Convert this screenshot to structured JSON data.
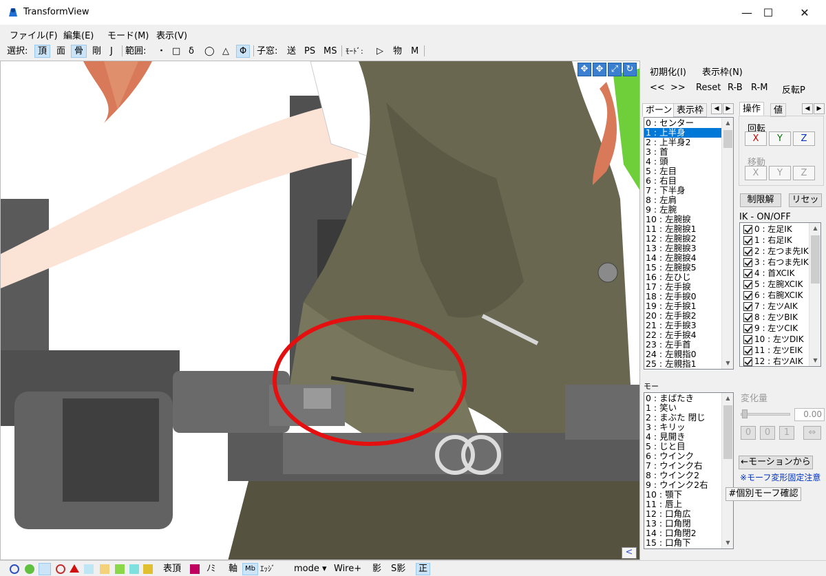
{
  "window": {
    "title": "TransformView",
    "minimize": "—",
    "maximize": "☐",
    "close": "✕"
  },
  "menu": [
    "ファイル(F)",
    "編集(E)",
    "モード(M)",
    "表示(V)"
  ],
  "toolbar": {
    "select_label": "選択:",
    "select": [
      "頂",
      "面",
      "骨",
      "剛",
      "J"
    ],
    "range_label": "範囲:",
    "range": [
      "・",
      "□",
      "δ",
      "◯",
      "△",
      "Φ"
    ],
    "child_label": "子窓:",
    "child": [
      "送",
      "PS",
      "MS"
    ],
    "mode_label": "ﾓｰﾄﾞ:",
    "mode": [
      "▷",
      "物",
      "M"
    ]
  },
  "panel": {
    "init": "初期化(I)",
    "display_frame": "表示枠(N)",
    "nav": [
      "<<",
      ">>",
      "Reset",
      "R-B",
      "R-M",
      "反転P"
    ],
    "left_tabs": [
      "ボーン",
      "表示枠"
    ],
    "right_tabs": [
      "操作",
      "値"
    ],
    "rotate_label": "回転",
    "move_label": "移動",
    "axes": [
      "X",
      "Y",
      "Z"
    ],
    "unlock": "制限解",
    "reset": "リセッ",
    "ik_label": "IK - ON/OFF",
    "morph_header": "モー",
    "change_label": "変化量",
    "change_value": "0.00",
    "morph_small": [
      "0",
      "0",
      "1",
      "⇔"
    ],
    "from_motion": "←モーションから",
    "note": "※モーフ変形固定注意",
    "check_morph": "#個別モーフ確認"
  },
  "bones": [
    "0 : センター",
    "1 : 上半身",
    "2 : 上半身2",
    "3 : 首",
    "4 : 頭",
    "5 : 左目",
    "6 : 右目",
    "7 : 下半身",
    "8 : 左肩",
    "9 : 左腕",
    "10 : 左腕捩",
    "11 : 左腕捩1",
    "12 : 左腕捩2",
    "13 : 左腕捩3",
    "14 : 左腕捩4",
    "15 : 左腕捩5",
    "16 : 左ひじ",
    "17 : 左手捩",
    "18 : 左手捩0",
    "19 : 左手捩1",
    "20 : 左手捩2",
    "21 : 左手捩3",
    "22 : 左手捩4",
    "23 : 左手首",
    "24 : 左親指0",
    "25 : 左親指1"
  ],
  "ik": [
    "0 : 左足IK",
    "1 : 右足IK",
    "2 : 左つま先IK",
    "3 : 右つま先IK",
    "4 : 首XCIK",
    "5 : 左腕XCIK",
    "6 : 右腕XCIK",
    "7 : 左ツAIK",
    "8 : 左ツBIK",
    "9 : 左ツCIK",
    "10 : 左ツDIK",
    "11 : 左ツEIK",
    "12 : 右ツAIK"
  ],
  "morphs": [
    "0 : まばたき",
    "1 : 笑い",
    "2 : まぶた 閉じ",
    "3 : キリッ",
    "4 : 見開き",
    "5 : じと目",
    "6 : ウインク",
    "7 : ウインク右",
    "8 : ウインク2",
    "9 : ウインク2右",
    "10 : 顎下",
    "11 : 唇上",
    "12 : 口角広",
    "13 : 口角閉",
    "14 : 口角閉2",
    "15 : 口角下"
  ],
  "status": {
    "items": [
      "表頂",
      "ﾉﾐ",
      "軸",
      "Mb",
      "ｴｯｼﾞ",
      "mode ▾",
      "Wire+",
      "影",
      "S影",
      "正"
    ]
  },
  "viewport": {
    "collapse": "<"
  },
  "colors": {
    "accent": "#0078d7",
    "axis_x": "#d00000",
    "axis_y": "#007000",
    "axis_z": "#0030c0",
    "annotation": "#e41010"
  }
}
